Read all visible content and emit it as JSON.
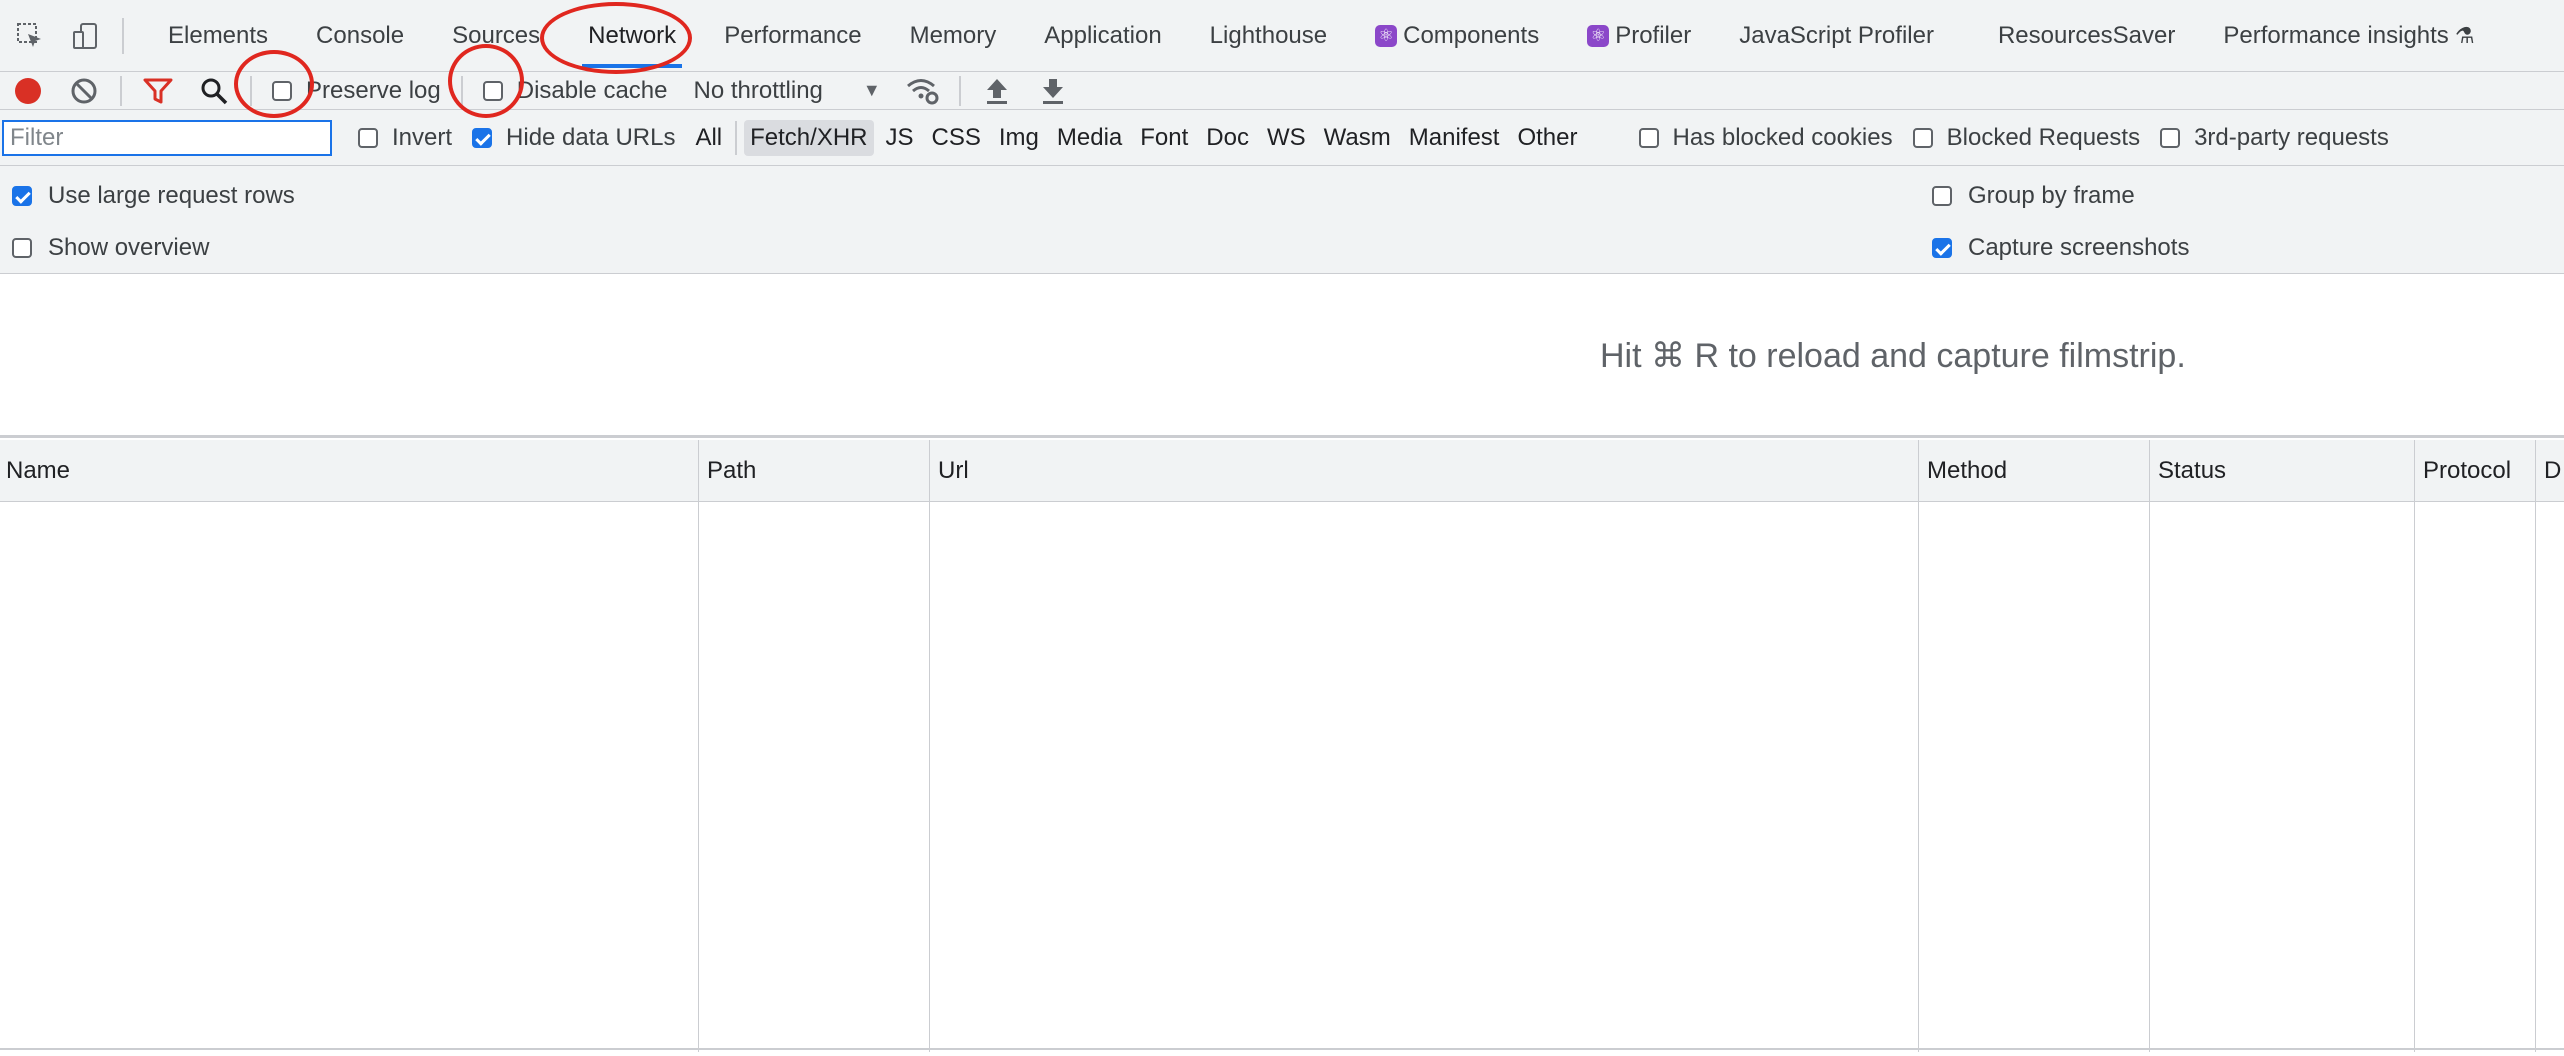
{
  "tabs": [
    {
      "label": "Elements"
    },
    {
      "label": "Console"
    },
    {
      "label": "Sources"
    },
    {
      "label": "Network"
    },
    {
      "label": "Performance"
    },
    {
      "label": "Memory"
    },
    {
      "label": "Application"
    },
    {
      "label": "Lighthouse"
    },
    {
      "label": "Components"
    },
    {
      "label": "Profiler"
    },
    {
      "label": "JavaScript Profiler"
    },
    {
      "label": "ResourcesSaver"
    },
    {
      "label": "Performance insights"
    }
  ],
  "active_tab": "Network",
  "toolbar": {
    "preserve_log": {
      "label": "Preserve log",
      "checked": false
    },
    "disable_cache": {
      "label": "Disable cache",
      "checked": false
    },
    "throttling": "No throttling"
  },
  "filterbar": {
    "filter_placeholder": "Filter",
    "invert": {
      "label": "Invert",
      "checked": false
    },
    "hide_data_urls": {
      "label": "Hide data URLs",
      "checked": true
    },
    "types": [
      "All",
      "Fetch/XHR",
      "JS",
      "CSS",
      "Img",
      "Media",
      "Font",
      "Doc",
      "WS",
      "Wasm",
      "Manifest",
      "Other"
    ],
    "selected_type": "Fetch/XHR",
    "has_blocked_cookies": {
      "label": "Has blocked cookies",
      "checked": false
    },
    "blocked_requests": {
      "label": "Blocked Requests",
      "checked": false
    },
    "third_party": {
      "label": "3rd-party requests",
      "checked": false
    }
  },
  "settings": {
    "large_rows": {
      "label": "Use large request rows",
      "checked": true
    },
    "show_overview": {
      "label": "Show overview",
      "checked": false
    },
    "group_by_frame": {
      "label": "Group by frame",
      "checked": false
    },
    "capture_screenshots": {
      "label": "Capture screenshots",
      "checked": true
    }
  },
  "filmstrip_message": "Hit ⌘ R to reload and capture filmstrip.",
  "table": {
    "columns": [
      "Name",
      "Path",
      "Url",
      "Method",
      "Status",
      "Protocol",
      "D"
    ]
  },
  "colors": {
    "accent": "#1a73e8",
    "record": "#d93025",
    "annotation": "#e0271f"
  }
}
